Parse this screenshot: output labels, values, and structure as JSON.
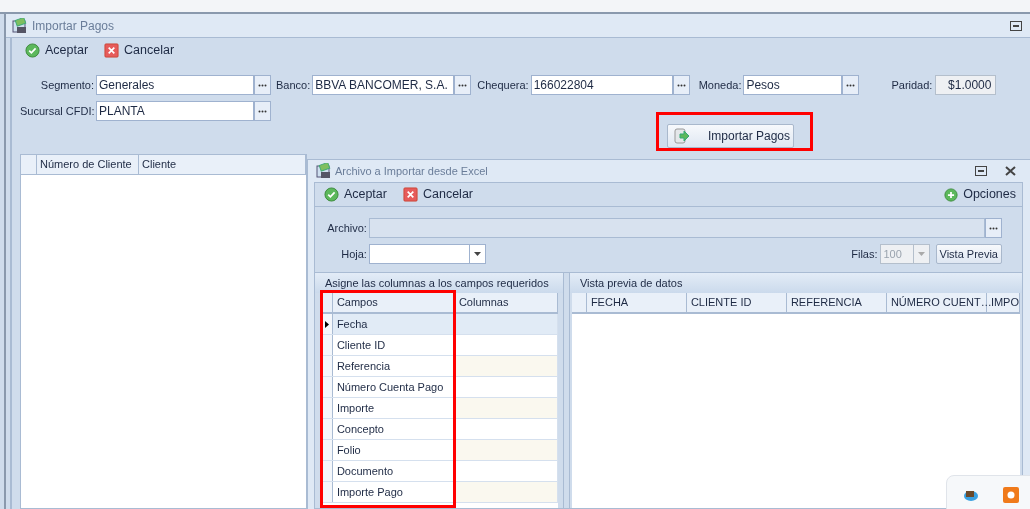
{
  "window": {
    "title": "Importar Pagos"
  },
  "toolbar": [
    {
      "kind": "accept",
      "label": "Aceptar"
    },
    {
      "kind": "cancel",
      "label": "Cancelar"
    }
  ],
  "field_rows": [
    [
      {
        "kind": "lookup",
        "label": "Segmento:",
        "value": "Generales"
      },
      {
        "kind": "lookup",
        "label": "Banco:",
        "value": "BBVA BANCOMER, S.A."
      },
      {
        "kind": "lookup",
        "label": "Chequera:",
        "value": "166022804"
      },
      {
        "kind": "lookup",
        "label": "Moneda:",
        "value": "Pesos"
      },
      {
        "kind": "readonly",
        "label": "Paridad:",
        "value": "$1.0000"
      }
    ],
    [
      {
        "kind": "lookup",
        "label": "Sucursal CFDI:",
        "value": "PLANTA"
      }
    ]
  ],
  "import_button": {
    "label": "Importar Pagos",
    "highlighted": true
  },
  "clients_grid": {
    "columns": [
      "Número de Cliente",
      "Cliente"
    ]
  },
  "dialog": {
    "title": "Archivo a Importar desde Excel",
    "toolbar": [
      {
        "kind": "accept",
        "label": "Aceptar"
      },
      {
        "kind": "cancel",
        "label": "Cancelar"
      }
    ],
    "options": "Opciones",
    "archivo": {
      "label": "Archivo:"
    },
    "hoja": {
      "label": "Hoja:"
    },
    "filas": {
      "label": "Filas:",
      "value": "100",
      "disabled": true
    },
    "preview_button": "Vista Previa",
    "mapping": {
      "title": "Asigne las columnas a los campos requeridos",
      "columns": [
        "Campos",
        "Columnas"
      ],
      "highlighted": true,
      "rows": [
        {
          "campo": "Fecha",
          "selected": true
        },
        {
          "campo": "Cliente ID",
          "selected": false
        },
        {
          "campo": "Referencia",
          "selected": false
        },
        {
          "campo": "Número Cuenta Pago",
          "selected": false
        },
        {
          "campo": "Importe",
          "selected": false
        },
        {
          "campo": "Concepto",
          "selected": false
        },
        {
          "campo": "Folio",
          "selected": false
        },
        {
          "campo": "Documento",
          "selected": false
        },
        {
          "campo": "Importe Pago",
          "selected": false
        }
      ]
    },
    "preview": {
      "title": "Vista previa de datos",
      "columns": [
        "FECHA",
        "CLIENTE ID",
        "REFERENCIA",
        "NÚMERO CUENT…",
        "IMPO"
      ]
    }
  }
}
